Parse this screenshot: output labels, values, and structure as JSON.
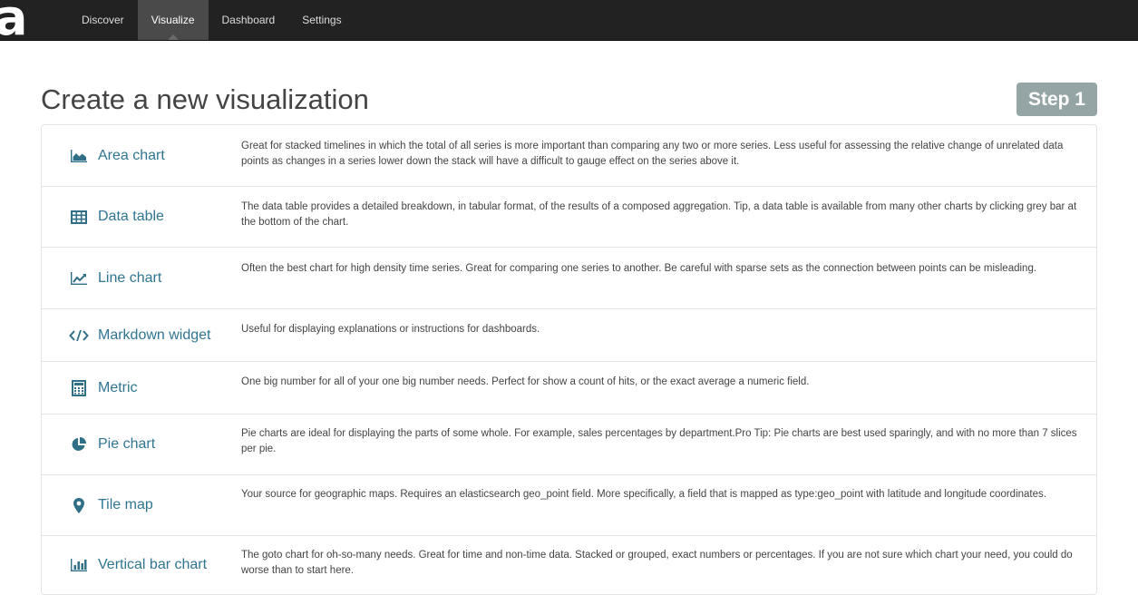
{
  "nav": {
    "logo": "a",
    "tabs": [
      {
        "label": "Discover",
        "active": false
      },
      {
        "label": "Visualize",
        "active": true
      },
      {
        "label": "Dashboard",
        "active": false
      },
      {
        "label": "Settings",
        "active": false
      }
    ]
  },
  "page": {
    "title": "Create a new visualization",
    "step": "Step 1"
  },
  "visualizations": [
    {
      "icon": "area-chart-icon",
      "label": "Area chart",
      "description": "Great for stacked timelines in which the total of all series is more important than comparing any two or more series. Less useful for assessing the relative change of unrelated data points as changes in a series lower down the stack will have a difficult to gauge effect on the series above it."
    },
    {
      "icon": "table-icon",
      "label": "Data table",
      "description": "The data table provides a detailed breakdown, in tabular format, of the results of a composed aggregation. Tip, a data table is available from many other charts by clicking grey bar at the bottom of the chart."
    },
    {
      "icon": "line-chart-icon",
      "label": "Line chart",
      "description": "Often the best chart for high density time series. Great for comparing one series to another. Be careful with sparse sets as the connection between points can be misleading."
    },
    {
      "icon": "code-icon",
      "label": "Markdown widget",
      "description": "Useful for displaying explanations or instructions for dashboards."
    },
    {
      "icon": "calculator-icon",
      "label": "Metric",
      "description": "One big number for all of your one big number needs. Perfect for show a count of hits, or the exact average a numeric field."
    },
    {
      "icon": "pie-chart-icon",
      "label": "Pie chart",
      "description": "Pie charts are ideal for displaying the parts of some whole. For example, sales percentages by department.Pro Tip: Pie charts are best used sparingly, and with no more than 7 slices per pie."
    },
    {
      "icon": "map-marker-icon",
      "label": "Tile map",
      "description": "Your source for geographic maps. Requires an elasticsearch geo_point field. More specifically, a field that is mapped as type:geo_point with latitude and longitude coordinates."
    },
    {
      "icon": "bar-chart-icon",
      "label": "Vertical bar chart",
      "description": "The goto chart for oh-so-many needs. Great for time and non-time data. Stacked or grouped, exact numbers or percentages. If you are not sure which chart your need, you could do worse than to start here."
    }
  ],
  "colors": {
    "navbar": "#222222",
    "accent": "#2f7592",
    "badge": "#95a5a6",
    "border": "#e4e4e4"
  }
}
